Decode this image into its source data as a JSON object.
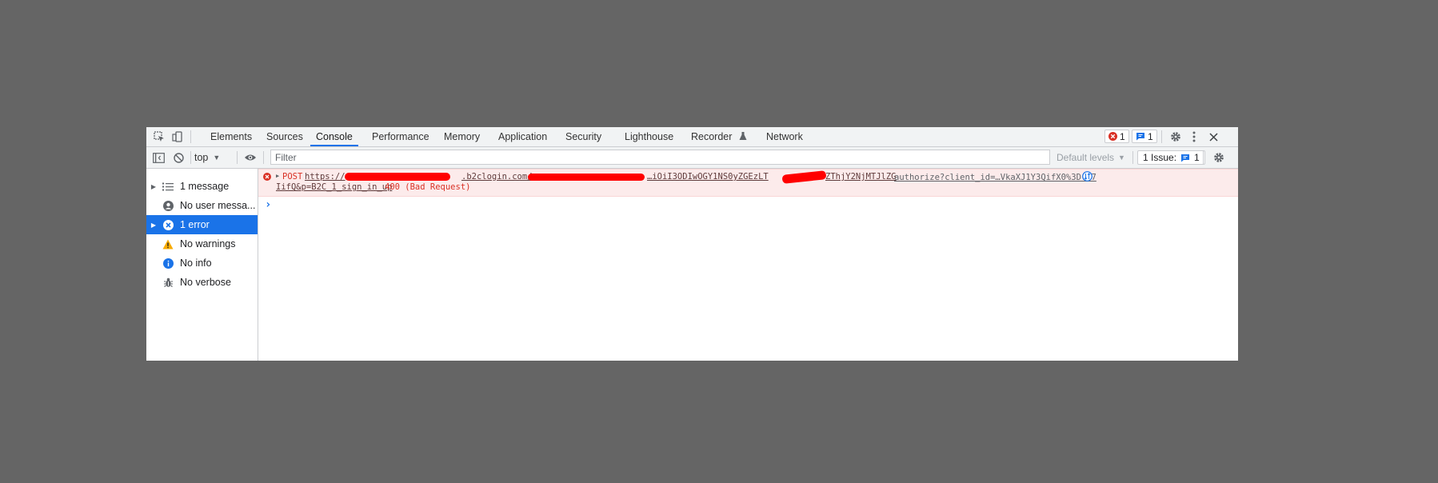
{
  "tabs": [
    "Elements",
    "Sources",
    "Console",
    "Performance",
    "Memory",
    "Application",
    "Security",
    "Lighthouse",
    "Recorder",
    "Network"
  ],
  "active_tab": "Console",
  "top_badges": {
    "errors": "1",
    "messages": "1"
  },
  "toolbar": {
    "context": "top",
    "filter_placeholder": "Filter",
    "levels": "Default levels",
    "issues_label": "1 Issue:",
    "issues_count": "1"
  },
  "sidebar": {
    "items": [
      {
        "label": "1 message",
        "icon": "list-icon"
      },
      {
        "label": "No user messa...",
        "icon": "user-icon"
      },
      {
        "label": "1 error",
        "icon": "error-icon"
      },
      {
        "label": "No warnings",
        "icon": "warning-icon"
      },
      {
        "label": "No info",
        "icon": "info-icon"
      },
      {
        "label": "No verbose",
        "icon": "bug-icon"
      }
    ]
  },
  "console": {
    "method": "POST",
    "url_start": "https://",
    "url_mid": ".b2clogin.com/",
    "url_token": "…iOiI3ODIwOGY1NS0yZGEzLT",
    "url_end": "ZThjY2NjMTJlZG",
    "source_link": "authorize?client_id=…VkaXJ1Y3QifX0%3D:17",
    "line2_link": "IifQ&p=B2C_1_sign_in_up",
    "status": "400 (Bad Request)",
    "prompt": "›"
  },
  "colors": {
    "accent": "#1a73e8",
    "error": "#d93025",
    "error_bg": "#fcebeb",
    "redaction": "#ff0000",
    "backdrop": "#656565"
  }
}
